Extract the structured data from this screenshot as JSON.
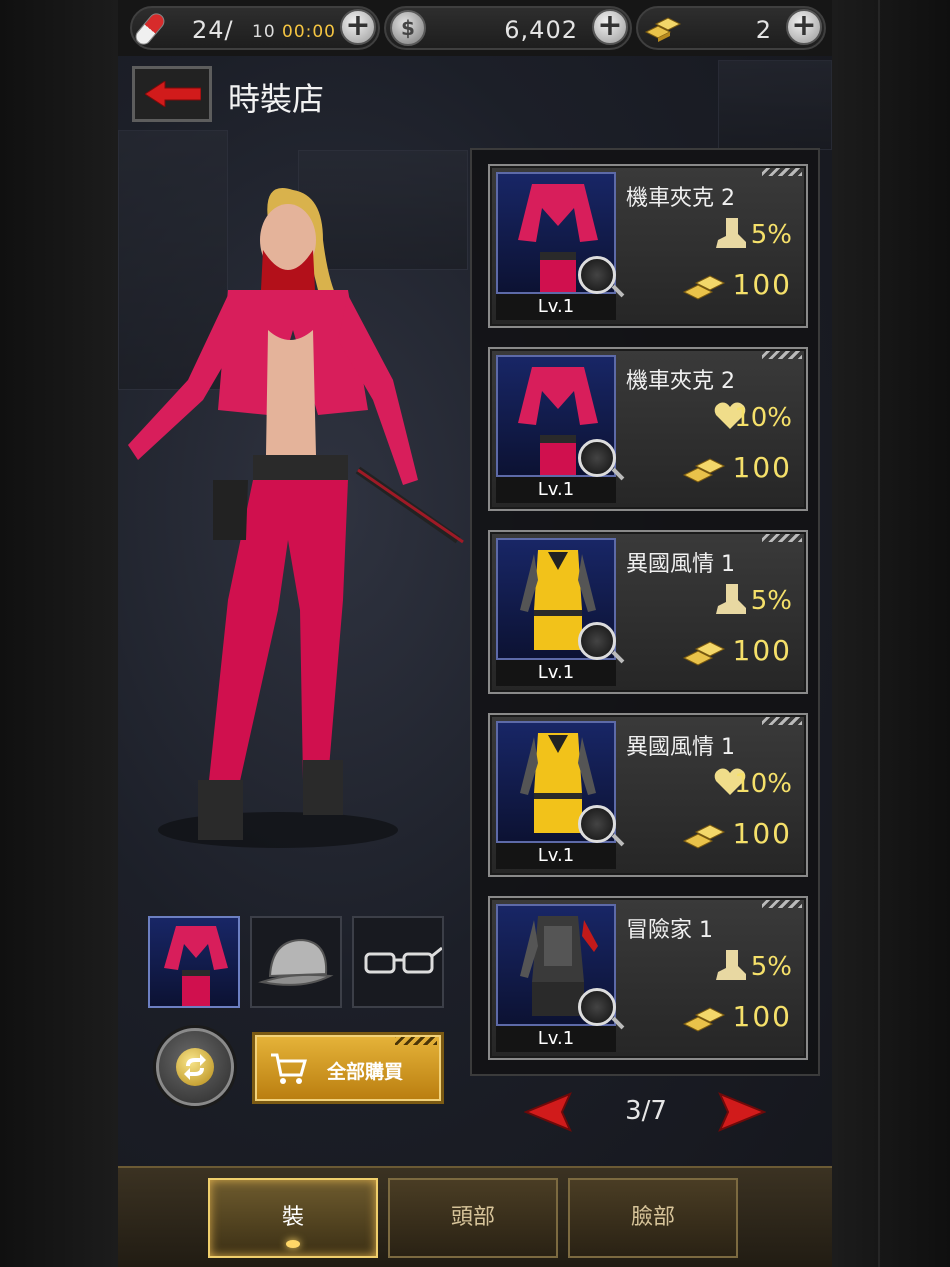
{
  "resources": {
    "energy": {
      "value": "24/",
      "cap": "10",
      "timer": "00:00"
    },
    "coins": {
      "value": "6,402"
    },
    "gold": {
      "value": "2"
    }
  },
  "header": {
    "title": "時裝店"
  },
  "items": [
    {
      "name": "機車夾克 2",
      "level": "Lv.1",
      "bonus_icon": "boot-icon",
      "bonus": "5%",
      "price": "100",
      "costume": "pink-jacket"
    },
    {
      "name": "機車夾克 2",
      "level": "Lv.1",
      "bonus_icon": "heart-icon",
      "bonus": "10%",
      "price": "100",
      "costume": "pink-jacket"
    },
    {
      "name": "異國風情 1",
      "level": "Lv.1",
      "bonus_icon": "boot-icon",
      "bonus": "5%",
      "price": "100",
      "costume": "yellow-dress"
    },
    {
      "name": "異國風情 1",
      "level": "Lv.1",
      "bonus_icon": "heart-icon",
      "bonus": "10%",
      "price": "100",
      "costume": "yellow-dress"
    },
    {
      "name": "冒險家 1",
      "level": "Lv.1",
      "bonus_icon": "boot-icon",
      "bonus": "5%",
      "price": "100",
      "costume": "black-armor"
    }
  ],
  "pagination": {
    "text": "3/7"
  },
  "buy_all": {
    "label": "全部購買"
  },
  "tabs": [
    {
      "label": "裝",
      "active": true
    },
    {
      "label": "頭部",
      "active": false
    },
    {
      "label": "臉部",
      "active": false
    }
  ],
  "colors": {
    "accent_gold": "#f5e06a",
    "back_red": "#d11b1b",
    "card_thumb_blue": "#182666"
  }
}
